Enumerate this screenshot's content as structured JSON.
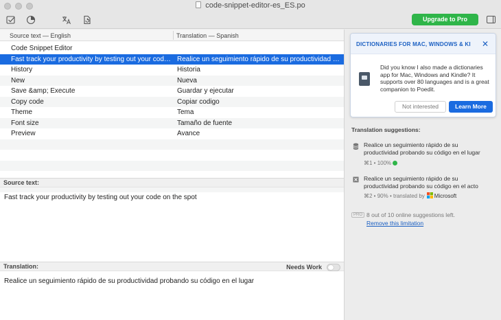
{
  "window": {
    "title": "code-snippet-editor-es_ES.po"
  },
  "toolbar": {
    "upgrade_label": "Upgrade to Pro",
    "icons": [
      "validate-icon",
      "pie-progress-icon",
      "translate-icon",
      "update-source-icon",
      "sidebar-toggle-icon"
    ]
  },
  "list": {
    "source_header": "Source text — English",
    "translation_header": "Translation — Spanish",
    "rows": [
      {
        "source": "Code Snippet Editor",
        "translation": ""
      },
      {
        "source": "Fast track your productivity by testing out your code on the spot",
        "translation": "Realice un seguimiento rápido de su productividad probando su código en el lugar"
      },
      {
        "source": "History",
        "translation": "Historia"
      },
      {
        "source": "New",
        "translation": "Nueva"
      },
      {
        "source": "Save &amp; Execute",
        "translation": "Guardar y ejecutar"
      },
      {
        "source": "Copy code",
        "translation": "Copiar codigo"
      },
      {
        "source": "Theme",
        "translation": "Tema"
      },
      {
        "source": "Font size",
        "translation": "Tamaño de fuente"
      },
      {
        "source": "Preview",
        "translation": "Avance"
      },
      {
        "source": "",
        "translation": ""
      },
      {
        "source": "",
        "translation": ""
      },
      {
        "source": "",
        "translation": ""
      },
      {
        "source": "",
        "translation": ""
      },
      {
        "source": "",
        "translation": ""
      },
      {
        "source": "",
        "translation": ""
      }
    ],
    "selected_index": 1
  },
  "editor": {
    "source_label": "Source text:",
    "source_text": "Fast track your productivity by testing out your code on the spot",
    "translation_label": "Translation:",
    "needs_work_label": "Needs Work",
    "translation_text": "Realice un seguimiento rápido de su productividad probando su código en el lugar"
  },
  "sidebar": {
    "promo": {
      "heading": "DICTIONARIES FOR MAC, WINDOWS & KI",
      "close": "✕",
      "body": "Did you know I also made a dictionaries app for Mac, Windows and Kindle? It supports over 80 languages and is a great companion to Poedit.",
      "not_interested": "Not interested",
      "learn_more": "Learn More"
    },
    "suggestions_title": "Translation suggestions:",
    "suggestions": [
      {
        "text": "Realice un seguimiento rápido de su productividad probando su código en el lugar",
        "shortcut": "⌘1",
        "score": "100%",
        "source_label": ""
      },
      {
        "text": "Realice un seguimiento rápido de su productividad probando su código en el acto",
        "shortcut": "⌘2",
        "score": "90%",
        "source_label": "translated by",
        "provider": "Microsoft"
      }
    ],
    "pro_tag": "PRO",
    "limit_text": "8 out of 10 online suggestions left.",
    "limit_link": "Remove this limitation"
  },
  "colors": {
    "accent": "#1a6be0",
    "upgrade": "#2fb549",
    "link": "#1a5fc2"
  }
}
